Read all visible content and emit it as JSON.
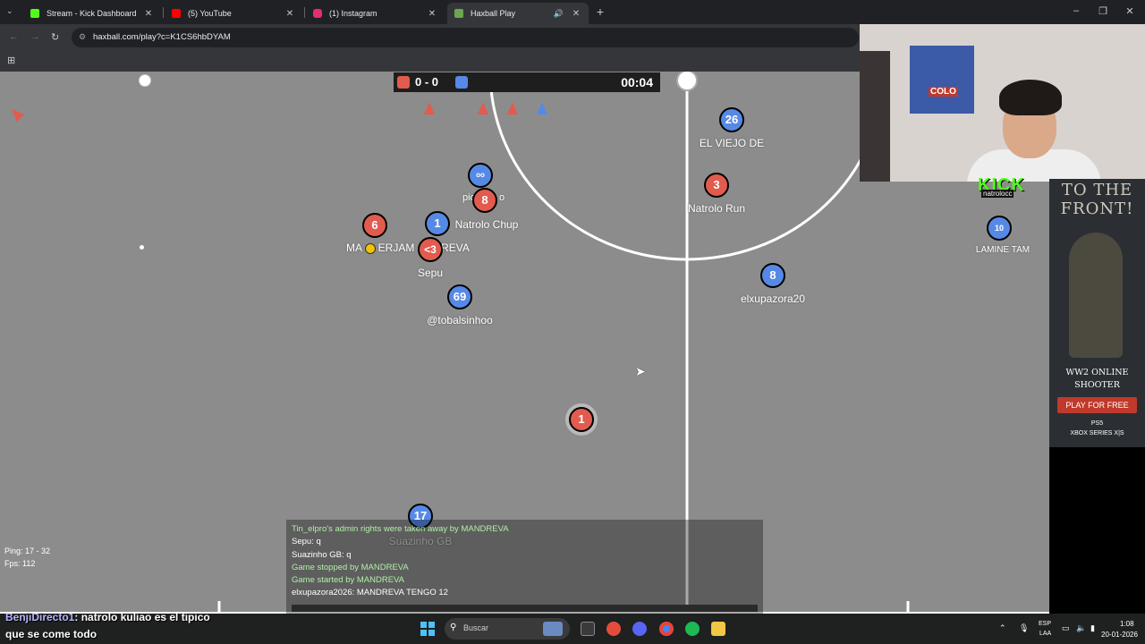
{
  "browser": {
    "tabs": [
      {
        "title": "Stream - Kick Dashboard",
        "color": "#53fc18"
      },
      {
        "title": "(5) YouTube",
        "color": "#ff0000"
      },
      {
        "title": "(1) Instagram",
        "color": "#e1306c"
      },
      {
        "title": "Haxball Play",
        "color": "#6aa84f"
      }
    ],
    "url": "haxball.com/play?c=K1CS6hbDYAM"
  },
  "game": {
    "score_red": 0,
    "score_blue": 0,
    "score_text": "0 - 0",
    "clock": "00:04",
    "players": [
      {
        "team": "blue",
        "number": "26",
        "name": "EL VIEJO DE"
      },
      {
        "team": "red",
        "number": "3",
        "name": "Natrolo Run"
      },
      {
        "team": "blue",
        "number": "",
        "name": "pic"
      },
      {
        "team": "red",
        "number": "8",
        "name": "o"
      },
      {
        "team": "red",
        "number": "6",
        "name": "MA"
      },
      {
        "team": "blue",
        "number": "1",
        "name": "Natrolo  Chup"
      },
      {
        "team": "red",
        "number": "<3",
        "name": "Sepu"
      },
      {
        "team": "blue",
        "number": "69",
        "name": "@tobalsinhoo"
      },
      {
        "team": "blue",
        "number": "8",
        "name": "elxupazora20"
      },
      {
        "team": "blue",
        "number": "10",
        "name": "LAMINE TAM"
      },
      {
        "team": "red",
        "number": "1",
        "name": ""
      },
      {
        "team": "blue",
        "number": "17",
        "name": "Suazinho GB"
      }
    ],
    "name_fragments": {
      "erjam": "ERJAM",
      "reva": "REVA"
    },
    "hud": {
      "ping": "Ping: 17 - 32",
      "fps": "Fps: 112"
    },
    "chat": [
      {
        "text": "Tin_elpro's admin rights were taken away by MANDREVA",
        "kind": "notice"
      },
      {
        "text": "Sepu: q",
        "kind": "msg"
      },
      {
        "text": "Suazinho GB: q",
        "kind": "msg"
      },
      {
        "text": "Game stopped by MANDREVA",
        "kind": "notice"
      },
      {
        "text": "Game started by MANDREVA",
        "kind": "notice"
      },
      {
        "text": "elxupazora2026: MANDREVA TENGO 12",
        "kind": "msg"
      }
    ]
  },
  "stream_overlay": {
    "kick_logo": "KICK",
    "kick_user": "natrolocc",
    "poster_text": "COLO",
    "chat_user": "BenjiDirecto1",
    "chat_line1": ": natrolo kuliao es el tipico",
    "chat_line2": "que se come todo"
  },
  "ad": {
    "headline": "TO THE FRONT!",
    "title_line1": "WW2 ONLINE",
    "title_line2": "SHOOTER",
    "button": "PLAY FOR FREE",
    "platform1": "PS5",
    "platform2": "XBOX SERIES X|S"
  },
  "taskbar": {
    "search_placeholder": "Buscar",
    "lang1": "ESP",
    "lang2": "LAA",
    "time": "1:08",
    "date": "20-01-2026"
  },
  "colors": {
    "red_team": "#e25b4f",
    "blue_team": "#5689e5",
    "field": "#8c8c8c",
    "notice_text": "#aff0a5"
  }
}
